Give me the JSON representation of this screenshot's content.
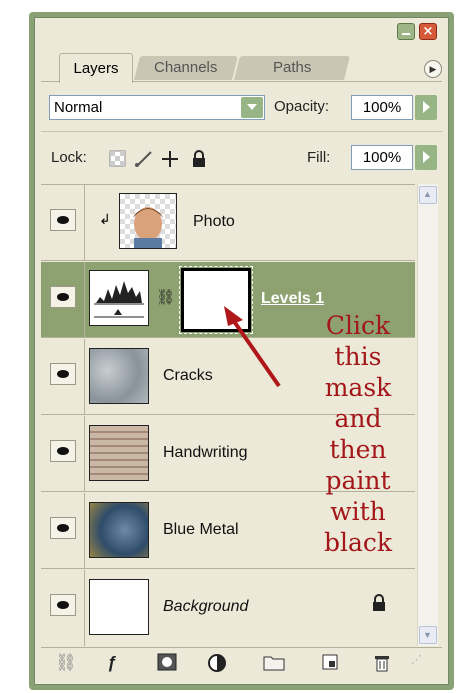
{
  "tabs": [
    {
      "label": "Layers"
    },
    {
      "label": "Channels"
    },
    {
      "label": "Paths"
    }
  ],
  "controls": {
    "blend_mode": "Normal",
    "opacity_label": "Opacity:",
    "opacity_value": "100%",
    "lock_label": "Lock:",
    "fill_label": "Fill:",
    "fill_value": "100%"
  },
  "layers": [
    {
      "name": "Photo",
      "clipped": true,
      "selected": false
    },
    {
      "name": "Levels 1",
      "type": "adjustment-levels",
      "selected": true
    },
    {
      "name": "Cracks",
      "selected": false
    },
    {
      "name": "Handwriting",
      "selected": false
    },
    {
      "name": "Blue Metal",
      "selected": false
    },
    {
      "name": "Background",
      "locked": true,
      "selected": false
    }
  ],
  "annotation": {
    "lines": [
      "Click",
      "this",
      "mask",
      "and",
      "then",
      "paint",
      "with",
      "black"
    ],
    "color": "#a3161a"
  },
  "colors": {
    "frame": "#89a174",
    "panel": "#ece9d8",
    "selected_row": "#8ea271",
    "button_accent": "#98b586",
    "close_button": "#d65a39"
  }
}
